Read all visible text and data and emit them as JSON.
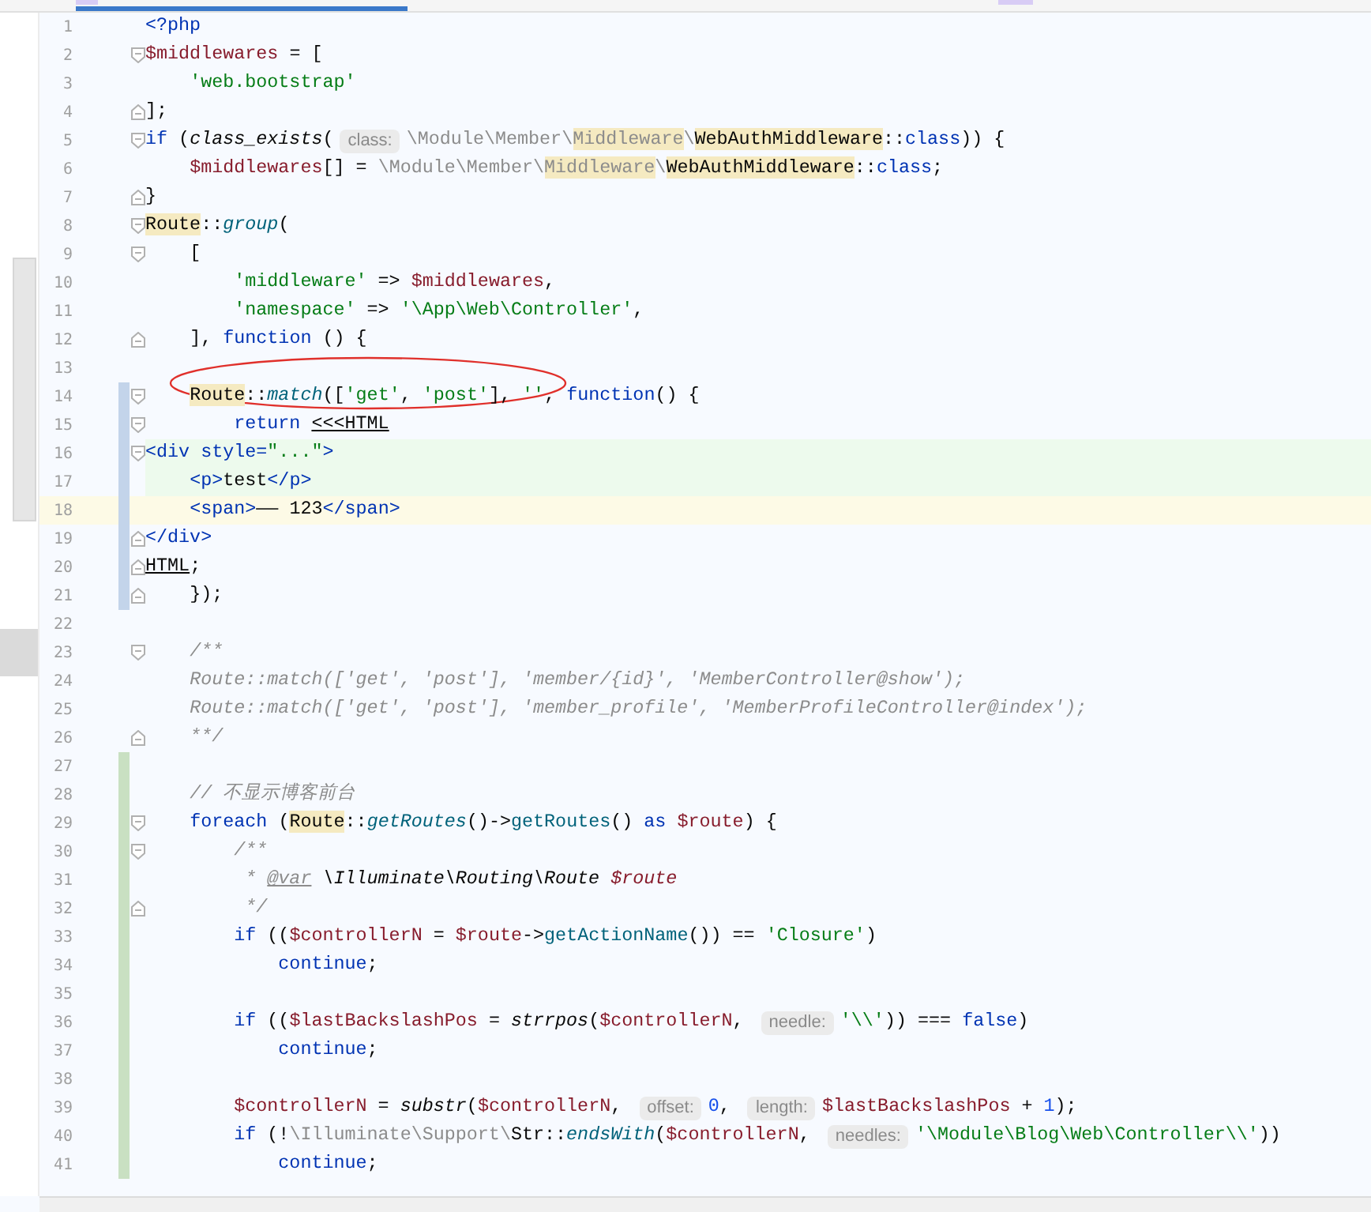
{
  "tabs": [
    {
      "selected": true
    }
  ],
  "lines": [
    {
      "number": "1",
      "fold_start": false,
      "fold_end": false,
      "modified": false,
      "added": false,
      "injected": false,
      "current": false,
      "tokens": [
        {
          "text": "<?php",
          "kind": "kw"
        }
      ]
    },
    {
      "number": "2",
      "fold_start": true,
      "fold_end": false,
      "modified": false,
      "added": false,
      "injected": false,
      "current": false,
      "tokens": [
        {
          "text": "$middlewares",
          "kind": "var"
        },
        {
          "text": " = [",
          "kind": "plain"
        }
      ]
    },
    {
      "number": "3",
      "fold_start": false,
      "fold_end": false,
      "modified": false,
      "added": false,
      "injected": false,
      "current": false,
      "tokens": [
        {
          "text": "    'web.bootstrap'",
          "kind": "str"
        }
      ]
    },
    {
      "number": "4",
      "fold_start": false,
      "fold_end": true,
      "modified": false,
      "added": false,
      "injected": false,
      "current": false,
      "tokens": [
        {
          "text": "];",
          "kind": "plain"
        }
      ]
    },
    {
      "number": "5",
      "fold_start": true,
      "fold_end": false,
      "modified": false,
      "added": false,
      "injected": false,
      "current": false,
      "tokens": [
        {
          "text": "if",
          "kind": "kw"
        },
        {
          "text": " (",
          "kind": "plain"
        },
        {
          "text": "class_exists",
          "kind": "bi"
        },
        {
          "text": "(",
          "kind": "plain"
        },
        {
          "text": "class:",
          "kind": "hint"
        },
        {
          "text": "\\Module\\Member\\",
          "kind": "ns"
        },
        {
          "text": "Middleware",
          "kind": "ns",
          "highlighted": true
        },
        {
          "text": "\\",
          "kind": "ns"
        },
        {
          "text": "WebAuthMiddleware",
          "kind": "plain",
          "highlighted": true
        },
        {
          "text": "::",
          "kind": "plain"
        },
        {
          "text": "class",
          "kind": "kw"
        },
        {
          "text": ")) {",
          "kind": "plain"
        }
      ]
    },
    {
      "number": "6",
      "fold_start": false,
      "fold_end": false,
      "modified": false,
      "added": false,
      "injected": false,
      "current": false,
      "tokens": [
        {
          "text": "    $middlewares",
          "kind": "var"
        },
        {
          "text": "[] = ",
          "kind": "plain"
        },
        {
          "text": "\\Module\\Member\\",
          "kind": "ns"
        },
        {
          "text": "Middleware",
          "kind": "ns",
          "highlighted": true
        },
        {
          "text": "\\",
          "kind": "ns"
        },
        {
          "text": "WebAuthMiddleware",
          "kind": "plain",
          "highlighted": true
        },
        {
          "text": "::",
          "kind": "plain"
        },
        {
          "text": "class",
          "kind": "kw"
        },
        {
          "text": ";",
          "kind": "plain"
        }
      ]
    },
    {
      "number": "7",
      "fold_start": false,
      "fold_end": true,
      "modified": false,
      "added": false,
      "injected": false,
      "current": false,
      "tokens": [
        {
          "text": "}",
          "kind": "plain"
        }
      ]
    },
    {
      "number": "8",
      "fold_start": true,
      "fold_end": false,
      "modified": false,
      "added": false,
      "injected": false,
      "current": false,
      "tokens": [
        {
          "text": "Route",
          "kind": "plain",
          "highlighted": true
        },
        {
          "text": "::",
          "kind": "plain"
        },
        {
          "text": "group",
          "kind": "fni"
        },
        {
          "text": "(",
          "kind": "plain"
        }
      ]
    },
    {
      "number": "9",
      "fold_start": true,
      "fold_end": false,
      "modified": false,
      "added": false,
      "injected": false,
      "current": false,
      "tokens": [
        {
          "text": "    [",
          "kind": "plain"
        }
      ]
    },
    {
      "number": "10",
      "fold_start": false,
      "fold_end": false,
      "modified": false,
      "added": false,
      "injected": false,
      "current": false,
      "tokens": [
        {
          "text": "        'middleware'",
          "kind": "str"
        },
        {
          "text": " => ",
          "kind": "plain"
        },
        {
          "text": "$middlewares",
          "kind": "var"
        },
        {
          "text": ",",
          "kind": "plain"
        }
      ]
    },
    {
      "number": "11",
      "fold_start": false,
      "fold_end": false,
      "modified": false,
      "added": false,
      "injected": false,
      "current": false,
      "tokens": [
        {
          "text": "        'namespace'",
          "kind": "str"
        },
        {
          "text": " => ",
          "kind": "plain"
        },
        {
          "text": "'\\App\\Web\\Controller'",
          "kind": "str"
        },
        {
          "text": ",",
          "kind": "plain"
        }
      ]
    },
    {
      "number": "12",
      "fold_start": false,
      "fold_end": true,
      "modified": false,
      "added": false,
      "injected": false,
      "current": false,
      "tokens": [
        {
          "text": "    ], ",
          "kind": "plain"
        },
        {
          "text": "function",
          "kind": "kw"
        },
        {
          "text": " () {",
          "kind": "plain"
        }
      ]
    },
    {
      "number": "13",
      "fold_start": false,
      "fold_end": false,
      "modified": false,
      "added": false,
      "injected": false,
      "current": false
    },
    {
      "number": "14",
      "fold_start": true,
      "fold_end": false,
      "modified": true,
      "added": false,
      "injected": false,
      "current": false,
      "tokens": [
        {
          "text": "    Route",
          "kind": "plain",
          "highlighted": true
        },
        {
          "text": "::",
          "kind": "plain"
        },
        {
          "text": "match",
          "kind": "fni"
        },
        {
          "text": "([",
          "kind": "plain"
        },
        {
          "text": "'get'",
          "kind": "str"
        },
        {
          "text": ", ",
          "kind": "plain"
        },
        {
          "text": "'post'",
          "kind": "str"
        },
        {
          "text": "], ",
          "kind": "plain"
        },
        {
          "text": "''",
          "kind": "str"
        },
        {
          "text": ", ",
          "kind": "plain"
        },
        {
          "text": "function",
          "kind": "kw"
        },
        {
          "text": "() {",
          "kind": "plain"
        }
      ]
    },
    {
      "number": "15",
      "fold_start": true,
      "fold_end": false,
      "modified": true,
      "added": false,
      "injected": false,
      "current": false,
      "tokens": [
        {
          "text": "        return",
          "kind": "kw"
        },
        {
          "text": " <<<HTML",
          "kind": "plain",
          "underlined": true
        }
      ]
    },
    {
      "number": "16",
      "fold_start": true,
      "fold_end": false,
      "modified": true,
      "added": false,
      "injected": true,
      "current": false,
      "tokens": [
        {
          "text": "<div",
          "kind": "tag"
        },
        {
          "text": " style=",
          "kind": "tag"
        },
        {
          "text": "\"...\"",
          "kind": "str"
        },
        {
          "text": ">",
          "kind": "tag"
        }
      ]
    },
    {
      "number": "17",
      "fold_start": false,
      "fold_end": false,
      "modified": true,
      "added": false,
      "injected": true,
      "current": false,
      "tokens": [
        {
          "text": "    <p>",
          "kind": "tag"
        },
        {
          "text": "test",
          "kind": "plain"
        },
        {
          "text": "</p>",
          "kind": "tag"
        }
      ]
    },
    {
      "number": "18",
      "fold_start": false,
      "fold_end": false,
      "modified": true,
      "added": false,
      "injected": false,
      "current": true,
      "tokens": [
        {
          "text": "    <span>",
          "kind": "tag"
        },
        {
          "text": "—— 123",
          "kind": "plain"
        },
        {
          "text": "</span>",
          "kind": "tag"
        }
      ]
    },
    {
      "number": "19",
      "fold_start": false,
      "fold_end": true,
      "modified": true,
      "added": false,
      "injected": false,
      "current": false,
      "tokens": [
        {
          "text": "</div>",
          "kind": "tag"
        }
      ]
    },
    {
      "number": "20",
      "fold_start": false,
      "fold_end": true,
      "modified": true,
      "added": false,
      "injected": false,
      "current": false,
      "tokens": [
        {
          "text": "HTML",
          "kind": "plain",
          "underlined": true
        },
        {
          "text": ";",
          "kind": "plain"
        }
      ]
    },
    {
      "number": "21",
      "fold_start": false,
      "fold_end": true,
      "modified": true,
      "added": false,
      "injected": false,
      "current": false,
      "tokens": [
        {
          "text": "    });",
          "kind": "plain"
        }
      ]
    },
    {
      "number": "22",
      "fold_start": false,
      "fold_end": false,
      "modified": false,
      "added": false,
      "injected": false,
      "current": false
    },
    {
      "number": "23",
      "fold_start": true,
      "fold_end": false,
      "modified": false,
      "added": false,
      "injected": false,
      "current": false,
      "tokens": [
        {
          "text": "    /**",
          "kind": "cm"
        }
      ]
    },
    {
      "number": "24",
      "fold_start": false,
      "fold_end": false,
      "modified": false,
      "added": false,
      "injected": false,
      "current": false,
      "tokens": [
        {
          "text": "    Route::match(['get', 'post'], 'member/{id}', 'MemberController@show');",
          "kind": "cm"
        }
      ]
    },
    {
      "number": "25",
      "fold_start": false,
      "fold_end": false,
      "modified": false,
      "added": false,
      "injected": false,
      "current": false,
      "tokens": [
        {
          "text": "    Route::match(['get', 'post'], 'member_profile', 'MemberProfileController@index');",
          "kind": "cm"
        }
      ]
    },
    {
      "number": "26",
      "fold_start": false,
      "fold_end": true,
      "modified": false,
      "added": false,
      "injected": false,
      "current": false,
      "tokens": [
        {
          "text": "    **/",
          "kind": "cm"
        }
      ]
    },
    {
      "number": "27",
      "fold_start": false,
      "fold_end": false,
      "modified": false,
      "added": true,
      "injected": false,
      "current": false
    },
    {
      "number": "28",
      "fold_start": false,
      "fold_end": false,
      "modified": false,
      "added": true,
      "injected": false,
      "current": false,
      "tokens": [
        {
          "text": "    // 不显示博客前台",
          "kind": "cm"
        }
      ]
    },
    {
      "number": "29",
      "fold_start": true,
      "fold_end": false,
      "modified": false,
      "added": true,
      "injected": false,
      "current": false,
      "tokens": [
        {
          "text": "    foreach",
          "kind": "kw"
        },
        {
          "text": " (",
          "kind": "plain"
        },
        {
          "text": "Route",
          "kind": "plain",
          "highlighted": true
        },
        {
          "text": "::",
          "kind": "plain"
        },
        {
          "text": "getRoutes",
          "kind": "fni"
        },
        {
          "text": "()->",
          "kind": "plain"
        },
        {
          "text": "getRoutes",
          "kind": "fn"
        },
        {
          "text": "() ",
          "kind": "plain"
        },
        {
          "text": "as",
          "kind": "kw"
        },
        {
          "text": " $route",
          "kind": "var"
        },
        {
          "text": ") {",
          "kind": "plain"
        }
      ]
    },
    {
      "number": "30",
      "fold_start": true,
      "fold_end": false,
      "modified": false,
      "added": true,
      "injected": false,
      "current": false,
      "tokens": [
        {
          "text": "        /**",
          "kind": "cm"
        }
      ]
    },
    {
      "number": "31",
      "fold_start": false,
      "fold_end": false,
      "modified": false,
      "added": true,
      "injected": false,
      "current": false,
      "tokens": [
        {
          "text": "         * ",
          "kind": "cm"
        },
        {
          "text": "@var",
          "kind": "cm",
          "underlined": true
        },
        {
          "text": " \\Illuminate\\Routing\\Route",
          "kind": "doc"
        },
        {
          "text": " $route",
          "kind": "docvar"
        }
      ]
    },
    {
      "number": "32",
      "fold_start": false,
      "fold_end": true,
      "modified": false,
      "added": true,
      "injected": false,
      "current": false,
      "tokens": [
        {
          "text": "         */",
          "kind": "cm"
        }
      ]
    },
    {
      "number": "33",
      "fold_start": false,
      "fold_end": false,
      "modified": false,
      "added": true,
      "injected": false,
      "current": false,
      "tokens": [
        {
          "text": "        if",
          "kind": "kw"
        },
        {
          "text": " ((",
          "kind": "plain"
        },
        {
          "text": "$controllerN",
          "kind": "var"
        },
        {
          "text": " = ",
          "kind": "plain"
        },
        {
          "text": "$route",
          "kind": "var"
        },
        {
          "text": "->",
          "kind": "plain"
        },
        {
          "text": "getActionName",
          "kind": "fn"
        },
        {
          "text": "()) == ",
          "kind": "plain"
        },
        {
          "text": "'Closure'",
          "kind": "str"
        },
        {
          "text": ")",
          "kind": "plain"
        }
      ]
    },
    {
      "number": "34",
      "fold_start": false,
      "fold_end": false,
      "modified": false,
      "added": true,
      "injected": false,
      "current": false,
      "tokens": [
        {
          "text": "            continue",
          "kind": "kw"
        },
        {
          "text": ";",
          "kind": "plain"
        }
      ]
    },
    {
      "number": "35",
      "fold_start": false,
      "fold_end": false,
      "modified": false,
      "added": true,
      "injected": false,
      "current": false
    },
    {
      "number": "36",
      "fold_start": false,
      "fold_end": false,
      "modified": false,
      "added": true,
      "injected": false,
      "current": false,
      "tokens": [
        {
          "text": "        if",
          "kind": "kw"
        },
        {
          "text": " ((",
          "kind": "plain"
        },
        {
          "text": "$lastBackslashPos",
          "kind": "var"
        },
        {
          "text": " = ",
          "kind": "plain"
        },
        {
          "text": "strrpos",
          "kind": "bi"
        },
        {
          "text": "(",
          "kind": "plain"
        },
        {
          "text": "$controllerN",
          "kind": "var"
        },
        {
          "text": ", ",
          "kind": "plain"
        },
        {
          "text": "needle:",
          "kind": "hint"
        },
        {
          "text": "'\\\\'",
          "kind": "str"
        },
        {
          "text": ")) === ",
          "kind": "plain"
        },
        {
          "text": "false",
          "kind": "kw"
        },
        {
          "text": ")",
          "kind": "plain"
        }
      ]
    },
    {
      "number": "37",
      "fold_start": false,
      "fold_end": false,
      "modified": false,
      "added": true,
      "injected": false,
      "current": false,
      "tokens": [
        {
          "text": "            continue",
          "kind": "kw"
        },
        {
          "text": ";",
          "kind": "plain"
        }
      ]
    },
    {
      "number": "38",
      "fold_start": false,
      "fold_end": false,
      "modified": false,
      "added": true,
      "injected": false,
      "current": false
    },
    {
      "number": "39",
      "fold_start": false,
      "fold_end": false,
      "modified": false,
      "added": true,
      "injected": false,
      "current": false,
      "tokens": [
        {
          "text": "        $controllerN",
          "kind": "var"
        },
        {
          "text": " = ",
          "kind": "plain"
        },
        {
          "text": "substr",
          "kind": "bi"
        },
        {
          "text": "(",
          "kind": "plain"
        },
        {
          "text": "$controllerN",
          "kind": "var"
        },
        {
          "text": ", ",
          "kind": "plain"
        },
        {
          "text": "offset:",
          "kind": "hint"
        },
        {
          "text": "0",
          "kind": "num"
        },
        {
          "text": ", ",
          "kind": "plain"
        },
        {
          "text": "length:",
          "kind": "hint"
        },
        {
          "text": "$lastBackslashPos",
          "kind": "var"
        },
        {
          "text": " + ",
          "kind": "plain"
        },
        {
          "text": "1",
          "kind": "num"
        },
        {
          "text": ");",
          "kind": "plain"
        }
      ]
    },
    {
      "number": "40",
      "fold_start": false,
      "fold_end": false,
      "modified": false,
      "added": true,
      "injected": false,
      "current": false,
      "tokens": [
        {
          "text": "        if",
          "kind": "kw"
        },
        {
          "text": " (!",
          "kind": "plain"
        },
        {
          "text": "\\Illuminate\\Support\\",
          "kind": "ns"
        },
        {
          "text": "Str",
          "kind": "plain"
        },
        {
          "text": "::",
          "kind": "plain"
        },
        {
          "text": "endsWith",
          "kind": "fni"
        },
        {
          "text": "(",
          "kind": "plain"
        },
        {
          "text": "$controllerN",
          "kind": "var"
        },
        {
          "text": ", ",
          "kind": "plain"
        },
        {
          "text": "needles:",
          "kind": "hint"
        },
        {
          "text": "'\\Module\\Blog\\Web\\Controller\\\\'",
          "kind": "str"
        },
        {
          "text": "))",
          "kind": "plain"
        }
      ]
    },
    {
      "number": "41",
      "fold_start": false,
      "fold_end": false,
      "modified": false,
      "added": true,
      "injected": false,
      "current": false,
      "tokens": [
        {
          "text": "            continue",
          "kind": "kw"
        },
        {
          "text": ";",
          "kind": "plain"
        }
      ]
    }
  ]
}
